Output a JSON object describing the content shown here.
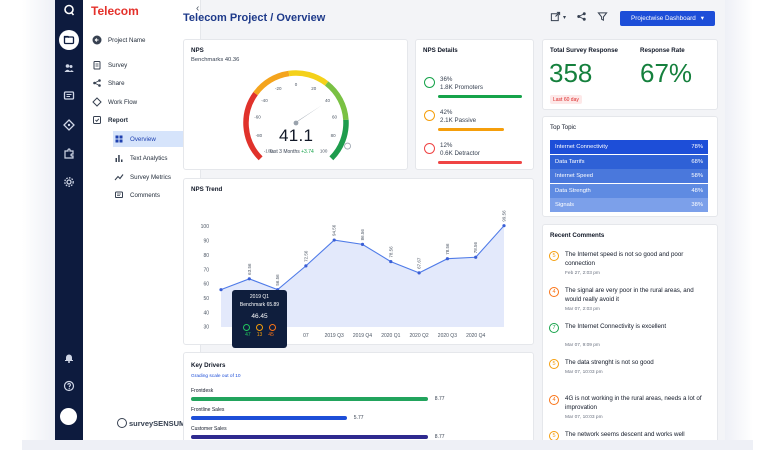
{
  "brand": "Telecom",
  "page_title": "Telecom Project / Overview",
  "dashboard_button": "Projectwise Dashboard",
  "nav": {
    "project_name": "Project Name",
    "items": [
      "Survey",
      "Share",
      "Work Flow",
      "Report"
    ],
    "report_sub": [
      "Overview",
      "Text Analytics",
      "Survey Metrics",
      "Comments"
    ]
  },
  "footer_logo": "surveySENSUM",
  "nps": {
    "title": "NPS",
    "benchmark": "Benchmarks 40.36",
    "score": "41.1",
    "period": "last 3 Months",
    "delta": "+3.74",
    "ticks": [
      "-100",
      "-80",
      "-60",
      "-40",
      "-20",
      "0",
      "20",
      "40",
      "60",
      "80",
      "100"
    ]
  },
  "nps_details": {
    "title": "NPS Details",
    "rows": [
      {
        "pct": "36%",
        "label": "1.8K Promoters",
        "color": "#16a34a",
        "fill": 0.95
      },
      {
        "pct": "42%",
        "label": "2.1K Passive",
        "color": "#f59e0b",
        "fill": 0.75
      },
      {
        "pct": "12%",
        "label": "0.6K Detractor",
        "color": "#ef4444",
        "fill": 0.95
      }
    ]
  },
  "total_response": {
    "title": "Total Survey Response",
    "value": "358",
    "chip": "Last 60 day"
  },
  "response_rate": {
    "title": "Response Rate",
    "value": "67%"
  },
  "top_topic": {
    "title": "Top Topic",
    "rows": [
      {
        "label": "Internet Connectivity",
        "pct": "78%"
      },
      {
        "label": "Data Tarrifs",
        "pct": "68%"
      },
      {
        "label": "Internet Speed",
        "pct": "58%"
      },
      {
        "label": "Data Strength",
        "pct": "48%"
      },
      {
        "label": "Signals",
        "pct": "38%"
      }
    ]
  },
  "nps_trend": {
    "title": "NPS Trend",
    "tooltip": {
      "quarter": "2019 Q1",
      "benchmark": "Benchmark 65.89",
      "value": "46.45",
      "promoters": "47",
      "passive": "13",
      "detractors": "45"
    }
  },
  "chart_data": {
    "type": "line",
    "title": "NPS Trend",
    "x": [
      "2018 Q3",
      "2018 Q4",
      "2019 Q1",
      "2019 Q2",
      "2019 Q3",
      "2019 Q4",
      "2020 Q1",
      "2020 Q2",
      "2020 Q3",
      "2020 Q4",
      "2021 Q1"
    ],
    "x_tick_labels": [
      "",
      "",
      "",
      "07",
      "2019 Q3",
      "2019 Q4",
      "2020 Q1",
      "2020 Q2",
      "2020 Q3",
      "2020 Q4",
      ""
    ],
    "series": [
      {
        "values": [
          56,
          63.56,
          56,
          72.56,
          90.56,
          87.56,
          75.56,
          67.67,
          77.56,
          78.56,
          100.56
        ]
      }
    ],
    "data_labels": [
      "",
      "63.56",
      "56.56",
      "72.56",
      "94.56",
      "86.56",
      "78.56",
      "67.67",
      "78.56",
      "78.56",
      "99.56"
    ],
    "y_ticks": [
      30,
      40,
      50,
      60,
      70,
      80,
      90,
      100
    ],
    "ylim": [
      30,
      108
    ],
    "grid": false
  },
  "key_drivers": {
    "title": "Key Drivers",
    "subtitle": "Grading scale out of 10",
    "rows": [
      {
        "label": "Frontdesk",
        "value": "8.77",
        "fill": 0.877,
        "color": "#22a45d"
      },
      {
        "label": "Frontline Sales",
        "value": "5.77",
        "fill": 0.577,
        "color": "#1d4ed8"
      },
      {
        "label": "Customer Sales",
        "value": "8.77",
        "fill": 0.877,
        "color": "#2e2a8f"
      }
    ]
  },
  "recent_comments": {
    "title": "Recent Comments",
    "items": [
      {
        "n": "5",
        "color": "#f59e0b",
        "text": "The Internet speed is not so good and poor connection",
        "date": "Feb 27, 2:03 pm"
      },
      {
        "n": "4",
        "color": "#f97316",
        "text": "The signal are very poor in the rural areas, and would really avoid it",
        "date": "Mar 07, 2:03 pm"
      },
      {
        "n": "7",
        "color": "#16a34a",
        "text": "The Internet Connectivity is excellent",
        "date": "Mar 07, 9:09 pm"
      },
      {
        "n": "5",
        "color": "#f59e0b",
        "text": "The data strenght is not so good",
        "date": "Mar 07, 10:03 pm"
      },
      {
        "n": "4",
        "color": "#f97316",
        "text": "4G is not working in the rural areas, needs a lot of improvation",
        "date": "Mar 07, 10:03 pm"
      },
      {
        "n": "5",
        "color": "#f59e0b",
        "text": "The network seems descent and works well",
        "date": ""
      }
    ]
  }
}
